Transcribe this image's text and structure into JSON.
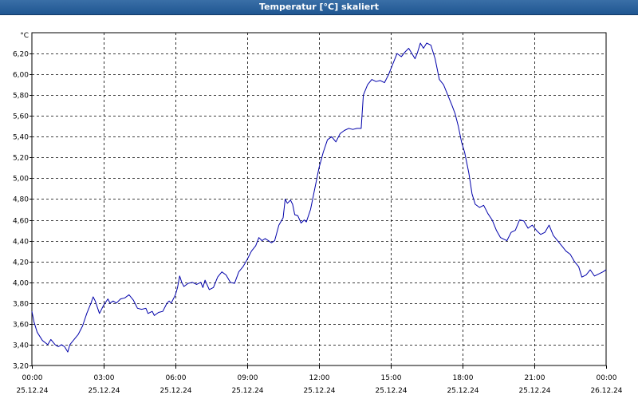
{
  "window": {
    "title": "Temperatur [°C] skaliert"
  },
  "chart_data": {
    "type": "line",
    "title": "Temperatur [°C] skaliert",
    "ylabel": "°C",
    "xlabel": "",
    "ylim": [
      3.2,
      6.4
    ],
    "xlim": [
      0,
      24
    ],
    "grid": true,
    "y_ticks": [
      "3,20",
      "3,40",
      "3,60",
      "3,80",
      "4,00",
      "4,20",
      "4,40",
      "4,60",
      "4,80",
      "5,00",
      "5,20",
      "5,40",
      "5,60",
      "5,80",
      "6,00",
      "6,20"
    ],
    "x_ticks": [
      {
        "time": "00:00",
        "date": "25.12.24"
      },
      {
        "time": "03:00",
        "date": "25.12.24"
      },
      {
        "time": "06:00",
        "date": "25.12.24"
      },
      {
        "time": "09:00",
        "date": "25.12.24"
      },
      {
        "time": "12:00",
        "date": "25.12.24"
      },
      {
        "time": "15:00",
        "date": "25.12.24"
      },
      {
        "time": "18:00",
        "date": "25.12.24"
      },
      {
        "time": "21:00",
        "date": "25.12.24"
      },
      {
        "time": "00:00",
        "date": "26.12.24"
      }
    ],
    "series": [
      {
        "color": "#0000aa",
        "points": [
          [
            0.0,
            3.72
          ],
          [
            0.1,
            3.62
          ],
          [
            0.25,
            3.52
          ],
          [
            0.5,
            3.44
          ],
          [
            0.75,
            3.4
          ],
          [
            0.9,
            3.45
          ],
          [
            1.1,
            3.4
          ],
          [
            1.25,
            3.38
          ],
          [
            1.4,
            3.4
          ],
          [
            1.55,
            3.38
          ],
          [
            1.7,
            3.33
          ],
          [
            1.8,
            3.4
          ],
          [
            2.0,
            3.45
          ],
          [
            2.2,
            3.5
          ],
          [
            2.4,
            3.58
          ],
          [
            2.6,
            3.7
          ],
          [
            2.8,
            3.8
          ],
          [
            2.9,
            3.86
          ],
          [
            3.0,
            3.82
          ],
          [
            3.2,
            3.7
          ],
          [
            3.4,
            3.78
          ],
          [
            3.6,
            3.84
          ],
          [
            3.7,
            3.8
          ],
          [
            3.85,
            3.82
          ],
          [
            4.0,
            3.8
          ],
          [
            4.2,
            3.84
          ],
          [
            4.4,
            3.85
          ],
          [
            4.6,
            3.88
          ],
          [
            4.8,
            3.83
          ],
          [
            5.0,
            3.75
          ],
          [
            5.2,
            3.74
          ],
          [
            5.4,
            3.75
          ],
          [
            5.5,
            3.7
          ],
          [
            5.7,
            3.72
          ],
          [
            5.8,
            3.68
          ],
          [
            6.0,
            3.71
          ],
          [
            6.2,
            3.72
          ],
          [
            6.4,
            3.8
          ],
          [
            6.5,
            3.82
          ],
          [
            6.6,
            3.8
          ],
          [
            6.8,
            3.88
          ],
          [
            6.9,
            3.95
          ],
          [
            7.0,
            4.06
          ],
          [
            7.1,
            4.0
          ],
          [
            7.2,
            3.96
          ],
          [
            7.4,
            3.99
          ],
          [
            7.6,
            4.0
          ],
          [
            7.8,
            3.98
          ],
          [
            8.0,
            4.0
          ],
          [
            8.1,
            3.95
          ],
          [
            8.2,
            4.02
          ],
          [
            8.4,
            3.93
          ],
          [
            8.6,
            3.95
          ],
          [
            8.8,
            4.05
          ],
          [
            9.0,
            4.1
          ],
          [
            9.2,
            4.07
          ],
          [
            9.4,
            4.0
          ],
          [
            9.6,
            3.99
          ],
          [
            9.8,
            4.1
          ],
          [
            10.0,
            4.15
          ],
          [
            10.2,
            4.22
          ],
          [
            10.4,
            4.3
          ],
          [
            10.6,
            4.35
          ],
          [
            10.75,
            4.43
          ],
          [
            10.9,
            4.4
          ],
          [
            11.05,
            4.42
          ],
          [
            11.2,
            4.4
          ],
          [
            11.35,
            4.38
          ],
          [
            11.5,
            4.4
          ],
          [
            11.7,
            4.55
          ],
          [
            11.9,
            4.62
          ],
          [
            12.0,
            4.8
          ],
          [
            12.1,
            4.76
          ],
          [
            12.25,
            4.79
          ],
          [
            12.35,
            4.75
          ],
          [
            12.45,
            4.65
          ],
          [
            12.6,
            4.64
          ],
          [
            12.75,
            4.57
          ],
          [
            12.9,
            4.6
          ],
          [
            13.0,
            4.58
          ],
          [
            13.2,
            4.7
          ],
          [
            13.4,
            4.9
          ],
          [
            13.6,
            5.1
          ],
          [
            13.8,
            5.25
          ],
          [
            14.0,
            5.37
          ],
          [
            14.2,
            5.4
          ],
          [
            14.4,
            5.35
          ],
          [
            14.6,
            5.43
          ],
          [
            14.8,
            5.46
          ],
          [
            15.0,
            5.48
          ],
          [
            15.2,
            5.47
          ],
          [
            15.4,
            5.48
          ],
          [
            15.6,
            5.48
          ],
          [
            15.7,
            5.8
          ],
          [
            15.9,
            5.9
          ],
          [
            16.1,
            5.95
          ],
          [
            16.3,
            5.93
          ],
          [
            16.5,
            5.94
          ],
          [
            16.7,
            5.92
          ],
          [
            16.9,
            6.0
          ],
          [
            17.1,
            6.1
          ],
          [
            17.3,
            6.2
          ],
          [
            17.5,
            6.17
          ],
          [
            17.7,
            6.22
          ],
          [
            17.85,
            6.25
          ],
          [
            18.0,
            6.2
          ],
          [
            18.15,
            6.15
          ],
          [
            18.25,
            6.2
          ],
          [
            18.4,
            6.3
          ],
          [
            18.55,
            6.25
          ],
          [
            18.7,
            6.3
          ],
          [
            18.9,
            6.28
          ],
          [
            19.1,
            6.15
          ],
          [
            19.3,
            5.95
          ],
          [
            19.5,
            5.9
          ],
          [
            19.7,
            5.8
          ],
          [
            19.9,
            5.7
          ],
          [
            20.05,
            5.62
          ],
          [
            20.2,
            5.5
          ],
          [
            20.35,
            5.35
          ],
          [
            20.5,
            5.25
          ],
          [
            20.7,
            5.05
          ],
          [
            20.85,
            4.85
          ],
          [
            21.0,
            4.75
          ],
          [
            21.2,
            4.72
          ],
          [
            21.4,
            4.74
          ],
          [
            21.6,
            4.66
          ],
          [
            21.8,
            4.6
          ],
          [
            22.0,
            4.5
          ],
          [
            22.2,
            4.43
          ],
          [
            22.4,
            4.41
          ],
          [
            22.5,
            4.4
          ],
          [
            22.7,
            4.48
          ],
          [
            22.9,
            4.5
          ],
          [
            23.1,
            4.6
          ],
          [
            23.3,
            4.59
          ],
          [
            23.5,
            4.52
          ],
          [
            23.7,
            4.55
          ],
          [
            23.9,
            4.5
          ],
          [
            24.1,
            4.46
          ],
          [
            24.3,
            4.48
          ],
          [
            24.5,
            4.55
          ],
          [
            24.7,
            4.45
          ],
          [
            24.9,
            4.4
          ],
          [
            25.1,
            4.35
          ],
          [
            25.3,
            4.3
          ],
          [
            25.5,
            4.27
          ],
          [
            25.7,
            4.2
          ],
          [
            25.9,
            4.15
          ],
          [
            26.05,
            4.05
          ],
          [
            26.25,
            4.07
          ],
          [
            26.45,
            4.12
          ],
          [
            26.65,
            4.06
          ],
          [
            26.85,
            4.08
          ],
          [
            27.05,
            4.1
          ],
          [
            27.2,
            4.12
          ]
        ]
      }
    ]
  }
}
